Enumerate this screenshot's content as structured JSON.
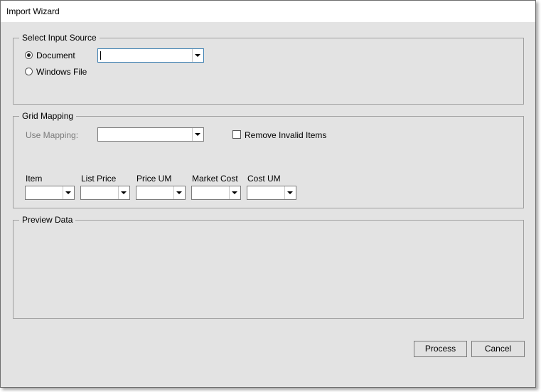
{
  "window": {
    "title": "Import Wizard"
  },
  "input_source": {
    "legend": "Select Input Source",
    "options": [
      {
        "label": "Document",
        "selected": true
      },
      {
        "label": "Windows File",
        "selected": false
      }
    ],
    "document_combo": {
      "value": ""
    }
  },
  "grid_mapping": {
    "legend": "Grid Mapping",
    "use_mapping_label": "Use Mapping:",
    "use_mapping_value": "",
    "remove_invalid_label": "Remove Invalid Items",
    "remove_invalid_checked": false,
    "columns": [
      {
        "label": "Item",
        "value": ""
      },
      {
        "label": "List Price",
        "value": ""
      },
      {
        "label": "Price UM",
        "value": ""
      },
      {
        "label": "Market Cost",
        "value": ""
      },
      {
        "label": "Cost UM",
        "value": ""
      }
    ]
  },
  "preview": {
    "legend": "Preview Data"
  },
  "buttons": {
    "process": "Process",
    "cancel": "Cancel"
  }
}
